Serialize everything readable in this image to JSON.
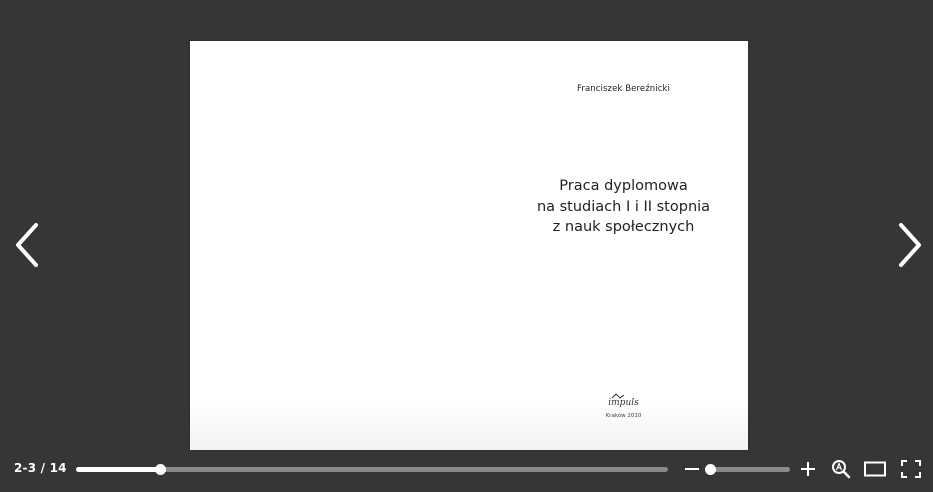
{
  "document": {
    "author": "Franciszek Bereźnicki",
    "title_lines": [
      "Praca dyplomowa",
      "na studiach I i II stopnia",
      "z nauk społecznych"
    ],
    "publisher_logo": "impuls",
    "publisher_city_year": "Kraków 2010"
  },
  "navigation": {
    "prev_icon": "chevron-left-icon",
    "next_icon": "chevron-right-icon"
  },
  "toolbar": {
    "page_counter": "2-3 / 14",
    "page_progress": 0.142,
    "zoom_level": 0.0,
    "icons": {
      "zoom_out": "minus-icon",
      "zoom_in": "plus-icon",
      "magnifier": "zoom-magnifier-icon",
      "single_page": "single-page-view-icon",
      "fullscreen": "fullscreen-icon"
    }
  },
  "colors": {
    "background": "#363636",
    "page": "#ffffff",
    "track": "#8a8a8a",
    "accent": "#ffffff"
  }
}
